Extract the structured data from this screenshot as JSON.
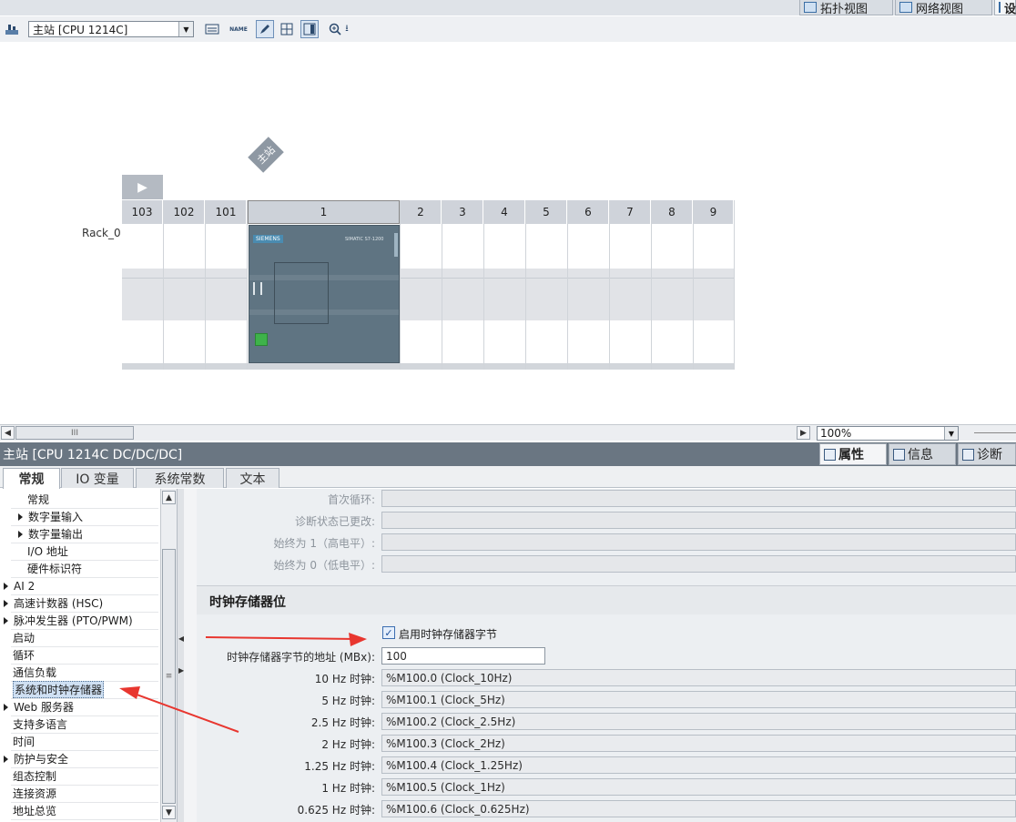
{
  "top_tabs": {
    "topology": "拓扑视图",
    "network": "网络视图",
    "device": "设"
  },
  "toolbar": {
    "device_select": "主站 [CPU 1214C]",
    "name_icon_text": "NAME"
  },
  "canvas": {
    "station_tag": "主站",
    "rack_label": "Rack_0",
    "slots": [
      "103",
      "102",
      "101",
      "1",
      "2",
      "3",
      "4",
      "5",
      "6",
      "7",
      "8",
      "9"
    ],
    "cpu": {
      "brand": "SIEMENS",
      "model": "SIMATIC S7-1200",
      "label": "CPU 1214C DC/DC/DC"
    }
  },
  "hscroll": {
    "thumb_glyph": "III",
    "zoom": "100%"
  },
  "inspector": {
    "title": "主站 [CPU 1214C DC/DC/DC]",
    "tabs": [
      "属性",
      "信息",
      "诊断"
    ],
    "section_tabs": [
      "常规",
      "IO 变量",
      "系统常数",
      "文本"
    ]
  },
  "nav": [
    {
      "label": "常规",
      "indent": 2,
      "expand": false
    },
    {
      "label": "数字量输入",
      "indent": 1,
      "expand": true
    },
    {
      "label": "数字量输出",
      "indent": 1,
      "expand": true
    },
    {
      "label": "I/O 地址",
      "indent": 2,
      "expand": false
    },
    {
      "label": "硬件标识符",
      "indent": 2,
      "expand": false
    },
    {
      "label": "AI 2",
      "indent": 0,
      "expand": true
    },
    {
      "label": "高速计数器 (HSC)",
      "indent": 0,
      "expand": true
    },
    {
      "label": "脉冲发生器 (PTO/PWM)",
      "indent": 0,
      "expand": true
    },
    {
      "label": "启动",
      "indent": 3,
      "expand": false
    },
    {
      "label": "循环",
      "indent": 3,
      "expand": false
    },
    {
      "label": "通信负载",
      "indent": 3,
      "expand": false
    },
    {
      "label": "系统和时钟存储器",
      "indent": 3,
      "expand": false,
      "selected": true
    },
    {
      "label": "Web 服务器",
      "indent": 0,
      "expand": true
    },
    {
      "label": "支持多语言",
      "indent": 3,
      "expand": false
    },
    {
      "label": "时间",
      "indent": 3,
      "expand": false
    },
    {
      "label": "防护与安全",
      "indent": 0,
      "expand": true
    },
    {
      "label": "组态控制",
      "indent": 3,
      "expand": false
    },
    {
      "label": "连接资源",
      "indent": 3,
      "expand": false
    },
    {
      "label": "地址总览",
      "indent": 3,
      "expand": false
    }
  ],
  "props": {
    "system_bits": [
      {
        "label": "首次循环:",
        "value": ""
      },
      {
        "label": "诊断状态已更改:",
        "value": ""
      },
      {
        "label": "始终为 1（高电平）:",
        "value": ""
      },
      {
        "label": "始终为 0（低电平）:",
        "value": ""
      }
    ],
    "section_title": "时钟存储器位",
    "enable_label": "启用时钟存储器字节",
    "enable_checked": true,
    "address_label": "时钟存储器字节的地址 (MBx):",
    "address_value": "100",
    "clocks": [
      {
        "label": "10 Hz 时钟:",
        "value": "%M100.0 (Clock_10Hz)"
      },
      {
        "label": "5 Hz 时钟:",
        "value": "%M100.1 (Clock_5Hz)"
      },
      {
        "label": "2.5 Hz 时钟:",
        "value": "%M100.2 (Clock_2.5Hz)"
      },
      {
        "label": "2 Hz 时钟:",
        "value": "%M100.3 (Clock_2Hz)"
      },
      {
        "label": "1.25 Hz 时钟:",
        "value": "%M100.4 (Clock_1.25Hz)"
      },
      {
        "label": "1 Hz 时钟:",
        "value": "%M100.5 (Clock_1Hz)"
      },
      {
        "label": "0.625 Hz 时钟:",
        "value": "%M100.6 (Clock_0.625Hz)"
      }
    ]
  },
  "colors": {
    "annotation_arrow": "#e8362f",
    "inspector_title_bg": "#6a7682",
    "cpu_body": "#5f7482"
  }
}
